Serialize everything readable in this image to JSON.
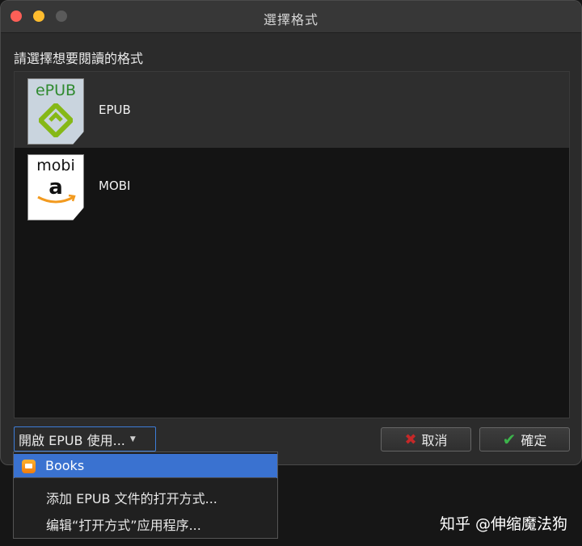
{
  "window": {
    "title": "選擇格式",
    "prompt": "請選擇想要閱讀的格式"
  },
  "formats": [
    {
      "label": "EPUB",
      "icon_text": "ePUB",
      "icon": "epub-icon",
      "selected": true
    },
    {
      "label": "MOBI",
      "icon_text": "mobi",
      "icon": "mobi-icon",
      "selected": false
    }
  ],
  "open_with": {
    "label": "開啟 EPUB 使用...",
    "arrow": "▼"
  },
  "buttons": {
    "cancel": {
      "label": "取消",
      "icon": "✖",
      "icon_color": "#c62828"
    },
    "confirm": {
      "label": "確定",
      "icon": "✔",
      "icon_color": "#3cb44b"
    }
  },
  "menu": {
    "items": [
      {
        "label": "Books",
        "highlighted": true,
        "icon": "books-app-icon"
      },
      {
        "label": "添加 EPUB 文件的打开方式..."
      },
      {
        "label": "编辑“打开方式”应用程序..."
      }
    ]
  },
  "watermark": "知乎 @伸缩魔法狗",
  "colors": {
    "accent": "#3a72d0",
    "background": "#2b2b2b",
    "list_bg": "#141414"
  }
}
